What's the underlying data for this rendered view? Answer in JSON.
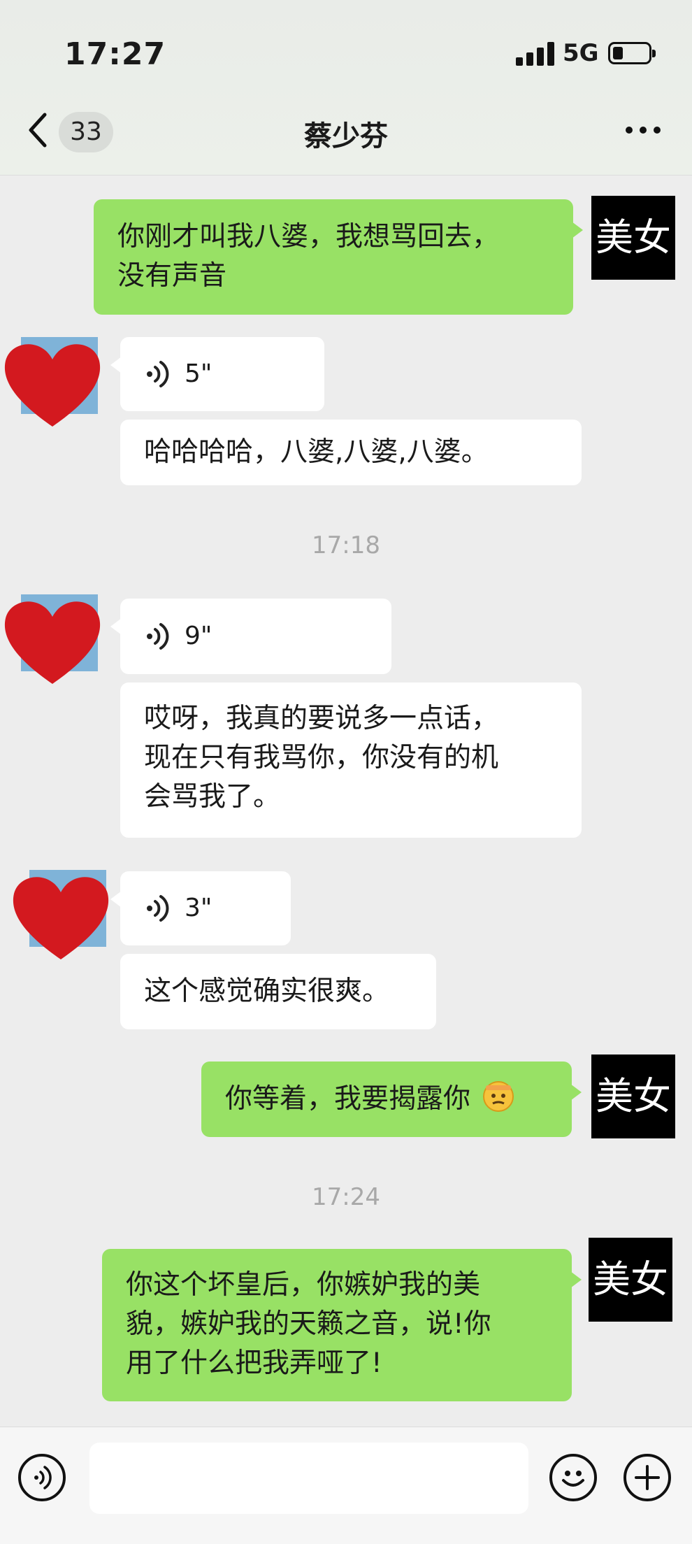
{
  "status": {
    "time": "17:27",
    "network": "5G"
  },
  "header": {
    "back_count": "33",
    "title": "蔡少芬"
  },
  "messages": {
    "m1": {
      "line1": "你刚才叫我八婆，我想骂回去，",
      "line2": "没有声音"
    },
    "v1": "5\"",
    "m2": "哈哈哈哈，八婆,八婆,八婆。",
    "ts1": "17:18",
    "v2": "9\"",
    "m3": {
      "line1": "哎呀，我真的要说多一点话，",
      "line2": "现在只有我骂你，你没有的机",
      "line3": "会骂我了。"
    },
    "v3": "3\"",
    "m4": "这个感觉确实很爽。",
    "m5": "你等着，我要揭露你",
    "ts2": "17:24",
    "m6": {
      "line1": "你这个坏皇后，你嫉妒我的美",
      "line2": "貌，嫉妒我的天籁之音，说!你",
      "line3": "用了什么把我弄哑了!"
    }
  },
  "me_avatar_label": "美女",
  "icons": {
    "back": "chevron-left-icon",
    "more": "more-dots-icon",
    "voice": "voice-wave-icon",
    "emoji": "emoji-face-icon",
    "plus": "plus-icon",
    "heart": "heart-avatar"
  },
  "colors": {
    "sent_bubble": "#98e165",
    "received_bubble": "#ffffff",
    "heart": "#d3191f"
  }
}
